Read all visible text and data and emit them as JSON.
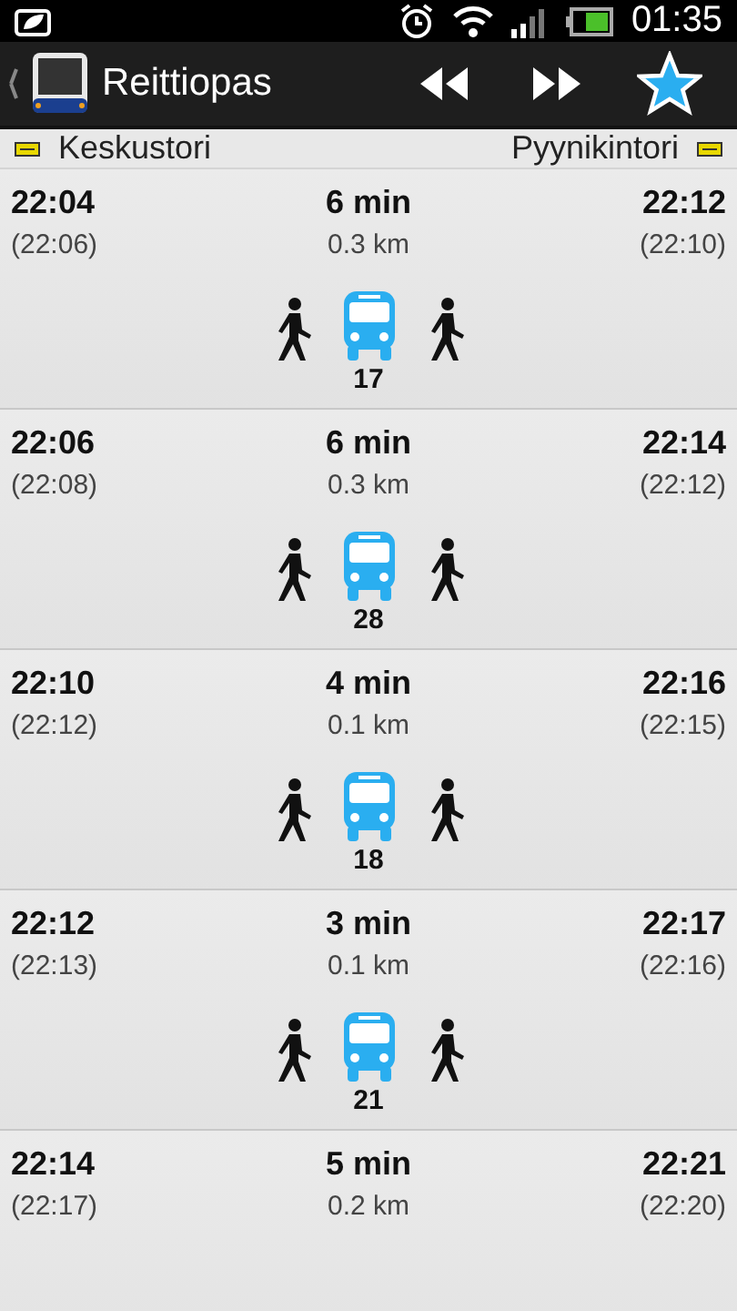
{
  "status_bar": {
    "time": "01:35"
  },
  "action_bar": {
    "title": "Reittiopas"
  },
  "header": {
    "from": "Keskustori",
    "to": "Pyynikintori"
  },
  "routes": [
    {
      "depart": "22:04",
      "depart_alt": "(22:06)",
      "duration": "6 min",
      "distance": "0.3 km",
      "arrive": "22:12",
      "arrive_alt": "(22:10)",
      "legs": [
        {
          "kind": "walk"
        },
        {
          "kind": "bus",
          "line": "17"
        },
        {
          "kind": "walk"
        }
      ]
    },
    {
      "depart": "22:06",
      "depart_alt": "(22:08)",
      "duration": "6 min",
      "distance": "0.3 km",
      "arrive": "22:14",
      "arrive_alt": "(22:12)",
      "legs": [
        {
          "kind": "walk"
        },
        {
          "kind": "bus",
          "line": "28"
        },
        {
          "kind": "walk"
        }
      ]
    },
    {
      "depart": "22:10",
      "depart_alt": "(22:12)",
      "duration": "4 min",
      "distance": "0.1 km",
      "arrive": "22:16",
      "arrive_alt": "(22:15)",
      "legs": [
        {
          "kind": "walk"
        },
        {
          "kind": "bus",
          "line": "18"
        },
        {
          "kind": "walk"
        }
      ]
    },
    {
      "depart": "22:12",
      "depart_alt": "(22:13)",
      "duration": "3 min",
      "distance": "0.1 km",
      "arrive": "22:17",
      "arrive_alt": "(22:16)",
      "legs": [
        {
          "kind": "walk"
        },
        {
          "kind": "bus",
          "line": "21"
        },
        {
          "kind": "walk"
        }
      ]
    },
    {
      "depart": "22:14",
      "depart_alt": "(22:17)",
      "duration": "5 min",
      "distance": "0.2 km",
      "arrive": "22:21",
      "arrive_alt": "(22:20)"
    }
  ]
}
